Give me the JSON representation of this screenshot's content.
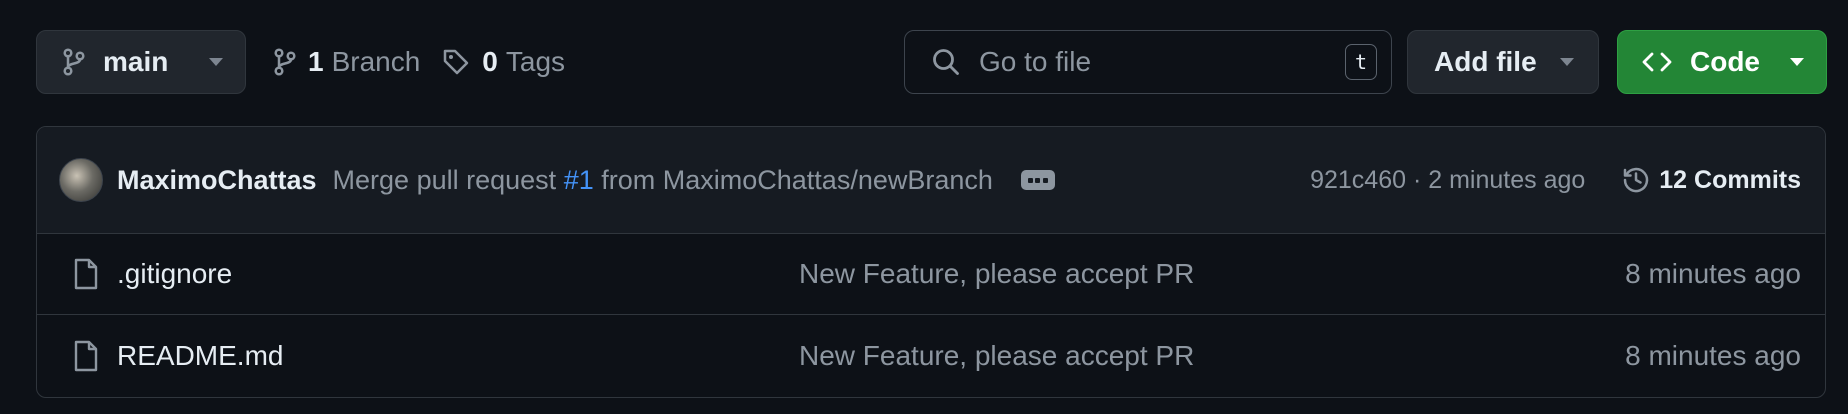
{
  "toolbar": {
    "branch_label": "main",
    "branches_count": "1",
    "branches_label": "Branch",
    "tags_count": "0",
    "tags_label": "Tags",
    "search_placeholder": "Go to file",
    "search_shortcut": "t",
    "add_file_label": "Add file",
    "code_label": "Code"
  },
  "latest_commit": {
    "author": "MaximoChattas",
    "message_prefix": "Merge pull request",
    "pr_link": "#1",
    "message_suffix": "from MaximoChattas/newBranch",
    "sha_time": "921c460 · 2 minutes ago",
    "commits_label": "12 Commits"
  },
  "files": [
    {
      "name": ".gitignore",
      "message": "New Feature, please accept PR",
      "time": "8 minutes ago"
    },
    {
      "name": "README.md",
      "message": "New Feature, please accept PR",
      "time": "8 minutes ago"
    }
  ],
  "colors": {
    "background": "#0d1117",
    "code_button": "#238636",
    "link": "#4493f8"
  }
}
